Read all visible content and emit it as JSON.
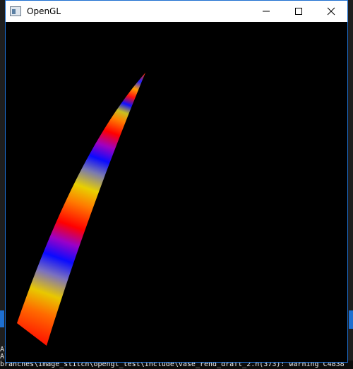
{
  "window": {
    "title": "OpenGL",
    "controls": {
      "minimize_icon": "minimize-icon",
      "maximize_icon": "maximize-icon",
      "close_icon": "close-icon"
    }
  },
  "console": {
    "side_line_1": "Al",
    "side_line_2": "Al",
    "bottom_line": "branches\\image_stitch\\opengl_test\\include\\vase_rend_draft_2.h(373): warning C4838"
  },
  "colors": {
    "accent": "#1e6fd0",
    "canvas_bg": "#000000",
    "gradient_bands": [
      "#ff0000",
      "#ffd000",
      "#0000ff",
      "#ff0000"
    ]
  }
}
